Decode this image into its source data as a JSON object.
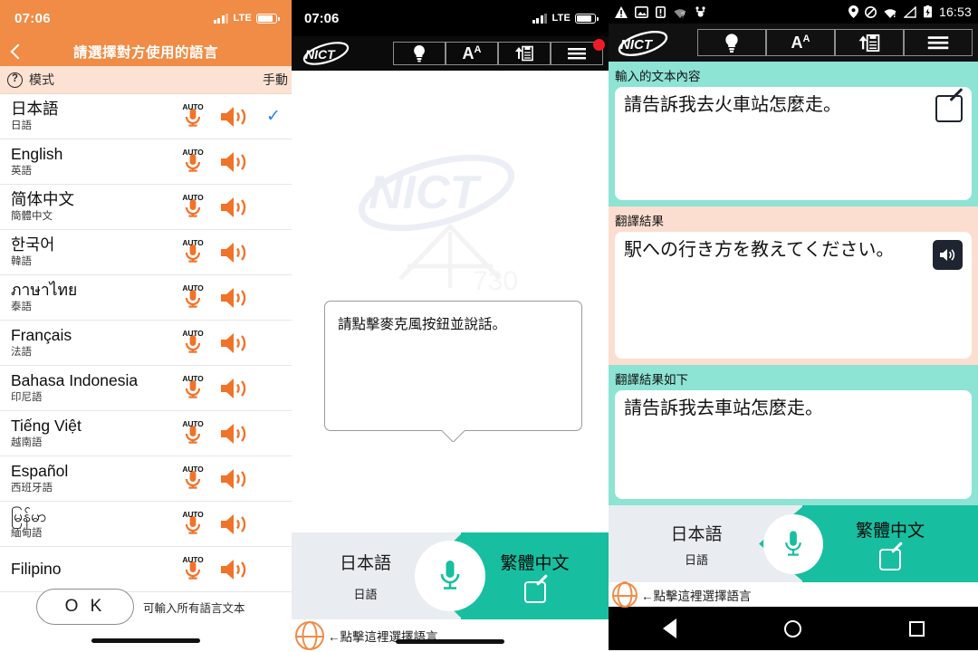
{
  "colors": {
    "orange": "#f08c46",
    "teal": "#17bfa0",
    "teal_light": "#8de3d4",
    "peach": "#fbded0",
    "peach_light": "#fbe2d2",
    "gray_panel": "#e9ecf1",
    "badge_red": "#ee1c25",
    "check_blue": "#2d7ef7"
  },
  "panel1": {
    "status": {
      "clock": "07:06",
      "network": "LTE"
    },
    "navbar": {
      "title": "請選擇對方使用的語言",
      "back_icon": "chevron-left-icon"
    },
    "mode_row": {
      "help_icon": "question-mark-icon",
      "label": "模式",
      "value": "手動"
    },
    "languages": [
      {
        "native": "日本語",
        "sub": "日語",
        "mic": "AUTO",
        "selected": true
      },
      {
        "native": "English",
        "sub": "英語",
        "mic": "AUTO",
        "selected": false
      },
      {
        "native": "简体中文",
        "sub": "簡體中文",
        "mic": "AUTO",
        "selected": false
      },
      {
        "native": "한국어",
        "sub": "韓語",
        "mic": "AUTO",
        "selected": false
      },
      {
        "native": "ภาษาไทย",
        "sub": "泰語",
        "mic": "AUTO",
        "selected": false
      },
      {
        "native": "Français",
        "sub": "法語",
        "mic": "AUTO",
        "selected": false
      },
      {
        "native": "Bahasa Indonesia",
        "sub": "印尼語",
        "mic": "AUTO",
        "selected": false
      },
      {
        "native": "Tiếng Việt",
        "sub": "越南語",
        "mic": "AUTO",
        "selected": false
      },
      {
        "native": "Español",
        "sub": "西班牙語",
        "mic": "AUTO",
        "selected": false
      },
      {
        "native": "မြန်မာ",
        "sub": "緬甸語",
        "mic": "AUTO",
        "selected": false
      },
      {
        "native": "Filipino",
        "sub": "",
        "mic": "AUTO",
        "selected": false
      }
    ],
    "ok_button": "O K",
    "ok_note": "可輸入所有語言文本"
  },
  "panel2": {
    "status": {
      "clock": "07:06",
      "network": "LTE"
    },
    "toolbar": {
      "logo": "NICT",
      "buttons": [
        {
          "icon": "lightbulb-icon",
          "label": ""
        },
        {
          "icon": "font-size-icon",
          "label": "A"
        },
        {
          "icon": "share-document-icon",
          "label": ""
        },
        {
          "icon": "hamburger-menu-icon",
          "label": "",
          "badge": true
        }
      ]
    },
    "watermark": "NICT",
    "bubble_text": "請點擊麥克風按鈕並說話。",
    "lang_bar": {
      "left_big": "日本語",
      "left_small": "日語",
      "right_big": "繁體中文",
      "mic_icon": "microphone-icon",
      "edit_icon": "edit-pencil-icon"
    },
    "hint": {
      "globe_icon": "globe-icon",
      "text": "←點擊這裡選擇語言"
    }
  },
  "panel3": {
    "status": {
      "clock": "16:53",
      "left_icons": [
        "warning-icon",
        "screenshot-icon",
        "sim-card-icon",
        "wifi-question-icon",
        "usb-debug-icon"
      ],
      "right_icons": [
        "location-icon",
        "do-not-disturb-icon",
        "wifi-alert-icon",
        "signal-icon",
        "battery-charging-icon"
      ]
    },
    "toolbar": {
      "logo": "NICT",
      "buttons": [
        {
          "icon": "lightbulb-icon",
          "label": ""
        },
        {
          "icon": "font-size-icon",
          "label": "A"
        },
        {
          "icon": "share-document-icon",
          "label": ""
        },
        {
          "icon": "hamburger-menu-icon",
          "label": ""
        }
      ]
    },
    "sections": [
      {
        "label": "輸入的文本內容",
        "text": "請告訴我去火車站怎麼走。",
        "button_icon": "edit-pencil-icon",
        "theme": "teal"
      },
      {
        "label": "翻譯結果",
        "text": "駅への行き方を教えてください。",
        "button_icon": "speaker-icon",
        "theme": "peach"
      },
      {
        "label": "翻譯結果如下",
        "text": "請告訴我去車站怎麼走。",
        "button_icon": "",
        "theme": "teal"
      }
    ],
    "lang_bar": {
      "left_big": "日本語",
      "left_small": "日語",
      "right_big": "繁體中文",
      "mic_icon": "microphone-icon",
      "edit_icon": "edit-pencil-icon"
    },
    "hint": {
      "globe_icon": "globe-icon",
      "text": "←點擊這裡選擇語言"
    },
    "navbar": {
      "back": "back-triangle-icon",
      "home": "home-circle-icon",
      "recents": "recents-square-icon"
    }
  }
}
